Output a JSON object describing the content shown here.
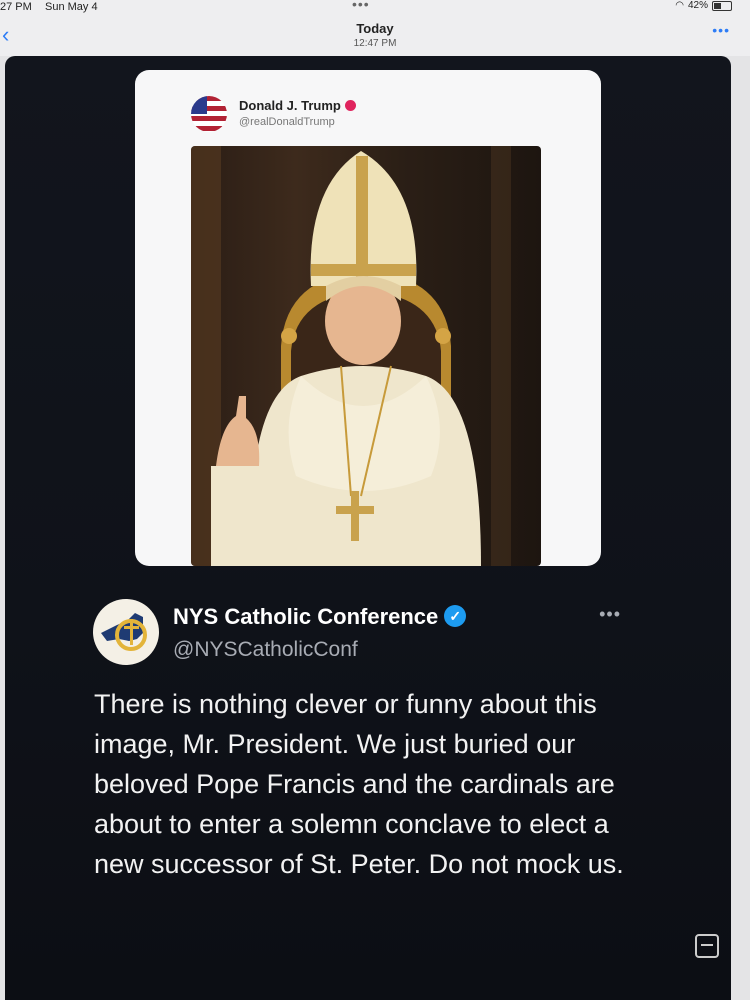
{
  "status_bar": {
    "time": "27 PM",
    "date": "Sun May 4",
    "battery": "42%"
  },
  "header": {
    "title": "Today",
    "time": "12:47 PM",
    "back_icon": "chevron-left-icon",
    "more_icon": "more-icon"
  },
  "quoted_post": {
    "author": "Donald J. Trump",
    "handle": "@realDonaldTrump",
    "image_description": "AI-generated image of Donald Trump dressed as the Pope"
  },
  "post": {
    "author": "NYS Catholic Conference",
    "handle": "@NYSCatholicConf",
    "text": "There is nothing clever or funny about this image, Mr. President. We just buried our beloved Pope Francis and the cardinals are about to enter a solemn conclave to elect a new successor of St. Peter. Do not mock us.",
    "more_label": "•••"
  },
  "colors": {
    "bubble_bg": "#12151d",
    "verified_blue": "#1d9bf0",
    "link_blue": "#2d7cf6"
  }
}
